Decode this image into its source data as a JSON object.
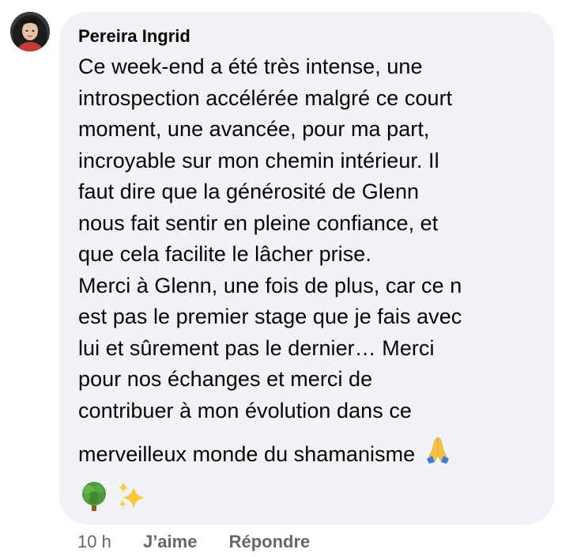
{
  "comment": {
    "author": "Pereira Ingrid",
    "lines": [
      "Ce week-end a été très intense, une",
      "introspection accélérée malgré ce court",
      "moment, une avancée, pour ma part,",
      "incroyable sur mon chemin intérieur. Il",
      "faut dire que la générosité de Glenn",
      "nous fait sentir en pleine confiance, et",
      "que cela facilite le lâcher prise.",
      "Merci à Glenn, une fois de plus, car ce n",
      "est pas le premier stage que je fais avec",
      "lui et sûrement pas le dernier… Merci",
      "pour nos échanges et merci de",
      "contribuer à mon évolution dans ce",
      "merveilleux monde du shamanisme"
    ],
    "emojis": [
      "folded-hands",
      "tree",
      "sparkles"
    ]
  },
  "footer": {
    "timestamp": "10 h",
    "like_label": "J’aime",
    "reply_label": "Répondre"
  },
  "colors": {
    "bubble_bg": "#f0f2f5",
    "text": "#050505",
    "secondary": "#65676b"
  }
}
